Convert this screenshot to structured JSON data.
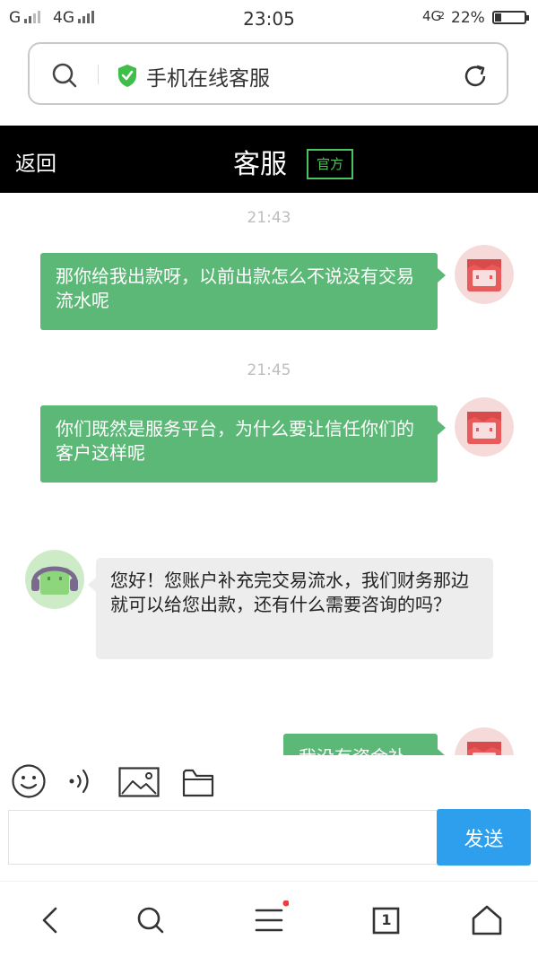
{
  "status_bar": {
    "carrier1": "G",
    "carrier2": "4G",
    "time": "23:05",
    "network": "4G",
    "network_sub": "2",
    "battery": "22%",
    "battery_level": 0.22
  },
  "url_bar": {
    "title": "手机在线客服"
  },
  "header": {
    "back_label": "返回",
    "title": "客服",
    "badge": "官方"
  },
  "messages": [
    {
      "type": "timestamp",
      "text": "21:43"
    },
    {
      "type": "sent",
      "text": "那你给我出款呀，以前出款怎么不说没有交易流水呢"
    },
    {
      "type": "timestamp",
      "text": "21:45"
    },
    {
      "type": "sent",
      "text": "你们既然是服务平台，为什么要让信任你们的客户这样呢"
    },
    {
      "type": "received",
      "text": "您好！您账户补充完交易流水，我们财务那边就可以给您出款，还有什么需要咨询的吗？"
    },
    {
      "type": "sent",
      "text": "我没有资金补"
    }
  ],
  "composer": {
    "placeholder": "",
    "send_label": "发送"
  },
  "bottom_nav": {
    "tab_count": "1"
  },
  "colors": {
    "sent_bubble": "#5cb877",
    "received_bubble": "#ededed",
    "header_bg": "#000000",
    "badge": "#4cc35c",
    "send_button": "#2d9fed",
    "menu_dot": "#f23a3a"
  }
}
